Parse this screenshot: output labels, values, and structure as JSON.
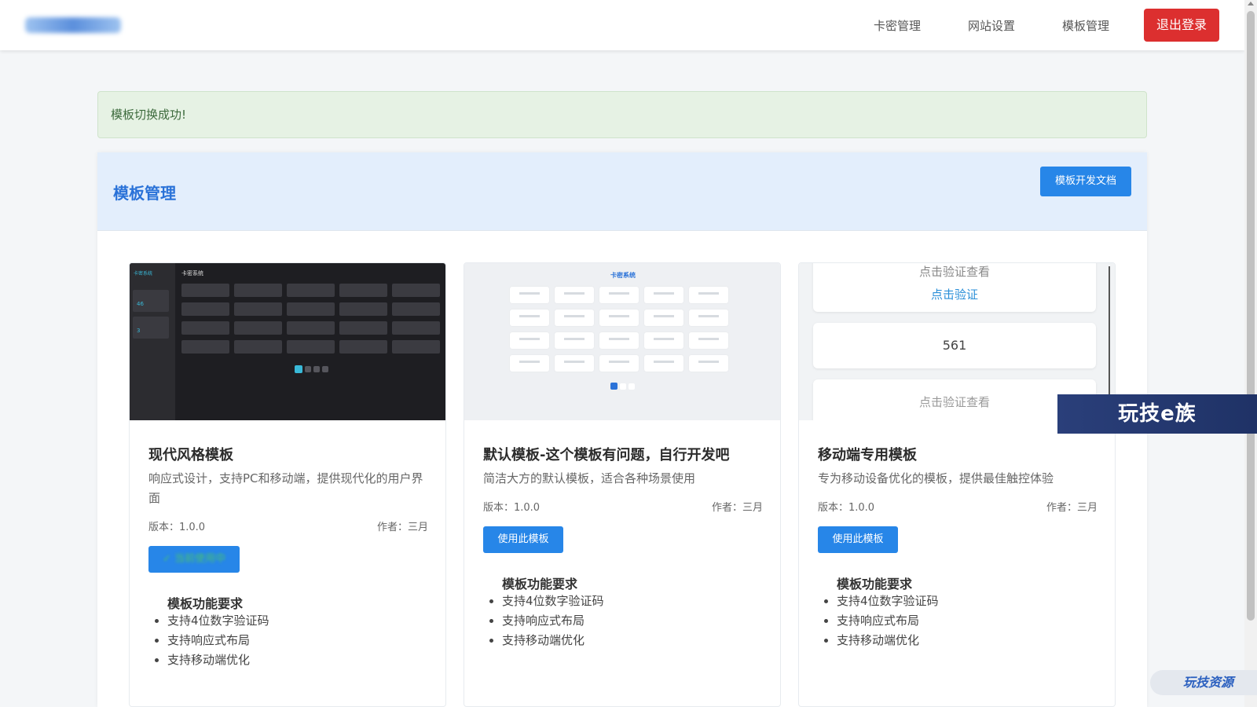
{
  "header": {
    "nav": [
      "卡密管理",
      "网站设置",
      "模板管理"
    ],
    "logout_label": "退出登录"
  },
  "alert": {
    "message": "模板切换成功!"
  },
  "panel": {
    "title": "模板管理",
    "doc_button": "模板开发文档"
  },
  "templates": [
    {
      "title": "现代风格模板",
      "description": "响应式设计，支持PC和移动端，提供现代化的用户界面",
      "version_label": "版本：1.0.0",
      "author_label": "作者：三月",
      "button_label": "✓ 当前使用中",
      "button_state": "current",
      "features_title": "模板功能要求",
      "features": [
        "支持4位数字验证码",
        "支持响应式布局",
        "支持移动端优化"
      ],
      "preview": {
        "header": "卡密系统",
        "stats": [
          "46",
          "3"
        ]
      }
    },
    {
      "title": "默认模板-这个模板有问题，自行开发吧",
      "description": "简洁大方的默认模板，适合各种场景使用",
      "version_label": "版本：1.0.0",
      "author_label": "作者：三月",
      "button_label": "使用此模板",
      "button_state": "available",
      "features_title": "模板功能要求",
      "features": [
        "支持4位数字验证码",
        "支持响应式布局",
        "支持移动端优化"
      ],
      "preview": {
        "header": "卡密系统"
      }
    },
    {
      "title": "移动端专用模板",
      "description": "专为移动设备优化的模板，提供最佳触控体验",
      "version_label": "版本：1.0.0",
      "author_label": "作者：三月",
      "button_label": "使用此模板",
      "button_state": "available",
      "features_title": "模板功能要求",
      "features": [
        "支持4位数字验证码",
        "支持响应式布局",
        "支持移动端优化"
      ],
      "preview": {
        "top_text": "点击验证查看",
        "verify_link": "点击验证",
        "number": "561",
        "bottom_text": "点击验证查看"
      }
    }
  ],
  "watermarks": {
    "banner": "玩技e族",
    "corner": "玩技资源"
  },
  "colors": {
    "primary": "#2786e8",
    "danger": "#dc2f2f",
    "success_bg": "#e6f2e4",
    "panel_head_bg": "#e3eefc"
  }
}
